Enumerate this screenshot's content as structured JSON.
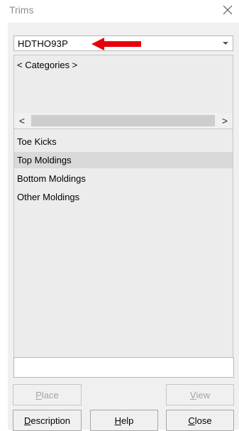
{
  "window": {
    "title": "Trims"
  },
  "combo": {
    "value": "HDTHO93P"
  },
  "categories": {
    "label": "< Categories >"
  },
  "scrollbar": {
    "left_glyph": "<",
    "right_glyph": ">"
  },
  "list": {
    "items": [
      {
        "label": "Toe Kicks",
        "selected": false
      },
      {
        "label": "Top Moldings",
        "selected": true
      },
      {
        "label": "Bottom Moldings",
        "selected": false
      },
      {
        "label": "Other Moldings",
        "selected": false
      }
    ]
  },
  "input": {
    "value": ""
  },
  "buttons": {
    "place": {
      "label": "Place",
      "accel": "P",
      "rest": "lace",
      "enabled": false
    },
    "view": {
      "label": "View",
      "accel": "V",
      "rest": "iew",
      "enabled": false
    },
    "description": {
      "label": "Description",
      "accel": "D",
      "rest": "escription",
      "enabled": true
    },
    "help": {
      "label": "Help",
      "accel": "H",
      "rest": "elp",
      "enabled": true
    },
    "close": {
      "label": "Close",
      "accel": "C",
      "rest": "lose",
      "enabled": true
    }
  },
  "colors": {
    "annotation_arrow": "#e8000b",
    "selected_row": "#d9d9d9",
    "panel_bg": "#f0f0f0"
  },
  "icons": {
    "close": "close-icon",
    "dropdown": "chevron-down-icon",
    "annotation": "red-arrow-icon"
  }
}
